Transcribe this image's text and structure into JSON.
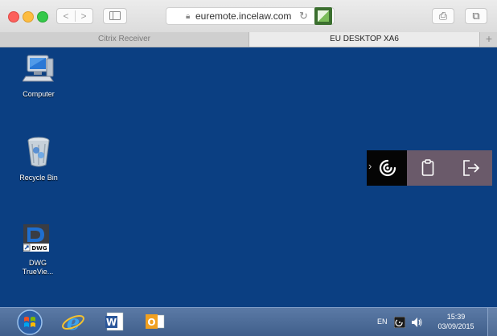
{
  "browser": {
    "url": "euremote.incelaw.com",
    "nav_back": "<",
    "nav_forward": ">",
    "share_glyph": "⎙",
    "tabs_glyph": "⧉"
  },
  "tabs": [
    {
      "label": "Citrix Receiver",
      "active": false
    },
    {
      "label": "EU DESKTOP XA6",
      "active": true
    }
  ],
  "new_tab_glyph": "+",
  "desktop": {
    "background": "#0b3f82",
    "icons": [
      {
        "label": "Computer",
        "icon": "computer-icon"
      },
      {
        "label": "Recycle Bin",
        "icon": "recycle-bin-icon"
      },
      {
        "label_line1": "DWG",
        "label_line2": "TrueVie...",
        "icon": "dwg-trueview-icon",
        "badge": "DWG"
      }
    ]
  },
  "citrix_toolbar": {
    "handle_glyph": "›",
    "items": [
      "citrix-receiver-icon",
      "clipboard-icon",
      "disconnect-icon"
    ]
  },
  "taskbar": {
    "apps": [
      "start-orb-icon",
      "internet-explorer-icon",
      "word-icon",
      "outlook-icon"
    ],
    "word_badge": "W",
    "outlook_badge": "O",
    "language": "EN",
    "time": "15:39",
    "date": "03/09/2015"
  }
}
